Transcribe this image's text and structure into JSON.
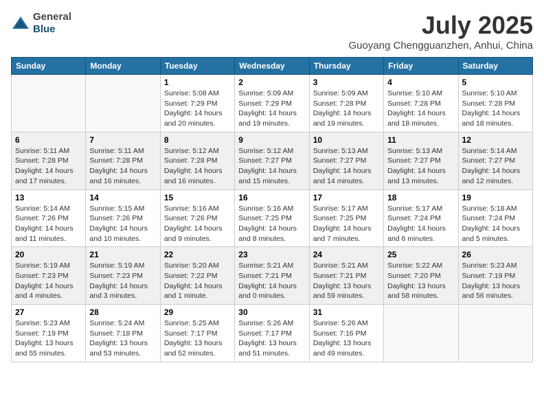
{
  "header": {
    "logo_general": "General",
    "logo_blue": "Blue",
    "month_year": "July 2025",
    "location": "Guoyang Chengguanzhen, Anhui, China"
  },
  "weekdays": [
    "Sunday",
    "Monday",
    "Tuesday",
    "Wednesday",
    "Thursday",
    "Friday",
    "Saturday"
  ],
  "weeks": [
    [
      {
        "day": "",
        "info": ""
      },
      {
        "day": "",
        "info": ""
      },
      {
        "day": "1",
        "info": "Sunrise: 5:08 AM\nSunset: 7:29 PM\nDaylight: 14 hours\nand 20 minutes."
      },
      {
        "day": "2",
        "info": "Sunrise: 5:09 AM\nSunset: 7:29 PM\nDaylight: 14 hours\nand 19 minutes."
      },
      {
        "day": "3",
        "info": "Sunrise: 5:09 AM\nSunset: 7:28 PM\nDaylight: 14 hours\nand 19 minutes."
      },
      {
        "day": "4",
        "info": "Sunrise: 5:10 AM\nSunset: 7:28 PM\nDaylight: 14 hours\nand 18 minutes."
      },
      {
        "day": "5",
        "info": "Sunrise: 5:10 AM\nSunset: 7:28 PM\nDaylight: 14 hours\nand 18 minutes."
      }
    ],
    [
      {
        "day": "6",
        "info": "Sunrise: 5:11 AM\nSunset: 7:28 PM\nDaylight: 14 hours\nand 17 minutes."
      },
      {
        "day": "7",
        "info": "Sunrise: 5:11 AM\nSunset: 7:28 PM\nDaylight: 14 hours\nand 16 minutes."
      },
      {
        "day": "8",
        "info": "Sunrise: 5:12 AM\nSunset: 7:28 PM\nDaylight: 14 hours\nand 16 minutes."
      },
      {
        "day": "9",
        "info": "Sunrise: 5:12 AM\nSunset: 7:27 PM\nDaylight: 14 hours\nand 15 minutes."
      },
      {
        "day": "10",
        "info": "Sunrise: 5:13 AM\nSunset: 7:27 PM\nDaylight: 14 hours\nand 14 minutes."
      },
      {
        "day": "11",
        "info": "Sunrise: 5:13 AM\nSunset: 7:27 PM\nDaylight: 14 hours\nand 13 minutes."
      },
      {
        "day": "12",
        "info": "Sunrise: 5:14 AM\nSunset: 7:27 PM\nDaylight: 14 hours\nand 12 minutes."
      }
    ],
    [
      {
        "day": "13",
        "info": "Sunrise: 5:14 AM\nSunset: 7:26 PM\nDaylight: 14 hours\nand 11 minutes."
      },
      {
        "day": "14",
        "info": "Sunrise: 5:15 AM\nSunset: 7:26 PM\nDaylight: 14 hours\nand 10 minutes."
      },
      {
        "day": "15",
        "info": "Sunrise: 5:16 AM\nSunset: 7:26 PM\nDaylight: 14 hours\nand 9 minutes."
      },
      {
        "day": "16",
        "info": "Sunrise: 5:16 AM\nSunset: 7:25 PM\nDaylight: 14 hours\nand 8 minutes."
      },
      {
        "day": "17",
        "info": "Sunrise: 5:17 AM\nSunset: 7:25 PM\nDaylight: 14 hours\nand 7 minutes."
      },
      {
        "day": "18",
        "info": "Sunrise: 5:17 AM\nSunset: 7:24 PM\nDaylight: 14 hours\nand 6 minutes."
      },
      {
        "day": "19",
        "info": "Sunrise: 5:18 AM\nSunset: 7:24 PM\nDaylight: 14 hours\nand 5 minutes."
      }
    ],
    [
      {
        "day": "20",
        "info": "Sunrise: 5:19 AM\nSunset: 7:23 PM\nDaylight: 14 hours\nand 4 minutes."
      },
      {
        "day": "21",
        "info": "Sunrise: 5:19 AM\nSunset: 7:23 PM\nDaylight: 14 hours\nand 3 minutes."
      },
      {
        "day": "22",
        "info": "Sunrise: 5:20 AM\nSunset: 7:22 PM\nDaylight: 14 hours\nand 1 minute."
      },
      {
        "day": "23",
        "info": "Sunrise: 5:21 AM\nSunset: 7:21 PM\nDaylight: 14 hours\nand 0 minutes."
      },
      {
        "day": "24",
        "info": "Sunrise: 5:21 AM\nSunset: 7:21 PM\nDaylight: 13 hours\nand 59 minutes."
      },
      {
        "day": "25",
        "info": "Sunrise: 5:22 AM\nSunset: 7:20 PM\nDaylight: 13 hours\nand 58 minutes."
      },
      {
        "day": "26",
        "info": "Sunrise: 5:23 AM\nSunset: 7:19 PM\nDaylight: 13 hours\nand 56 minutes."
      }
    ],
    [
      {
        "day": "27",
        "info": "Sunrise: 5:23 AM\nSunset: 7:19 PM\nDaylight: 13 hours\nand 55 minutes."
      },
      {
        "day": "28",
        "info": "Sunrise: 5:24 AM\nSunset: 7:18 PM\nDaylight: 13 hours\nand 53 minutes."
      },
      {
        "day": "29",
        "info": "Sunrise: 5:25 AM\nSunset: 7:17 PM\nDaylight: 13 hours\nand 52 minutes."
      },
      {
        "day": "30",
        "info": "Sunrise: 5:26 AM\nSunset: 7:17 PM\nDaylight: 13 hours\nand 51 minutes."
      },
      {
        "day": "31",
        "info": "Sunrise: 5:26 AM\nSunset: 7:16 PM\nDaylight: 13 hours\nand 49 minutes."
      },
      {
        "day": "",
        "info": ""
      },
      {
        "day": "",
        "info": ""
      }
    ]
  ]
}
